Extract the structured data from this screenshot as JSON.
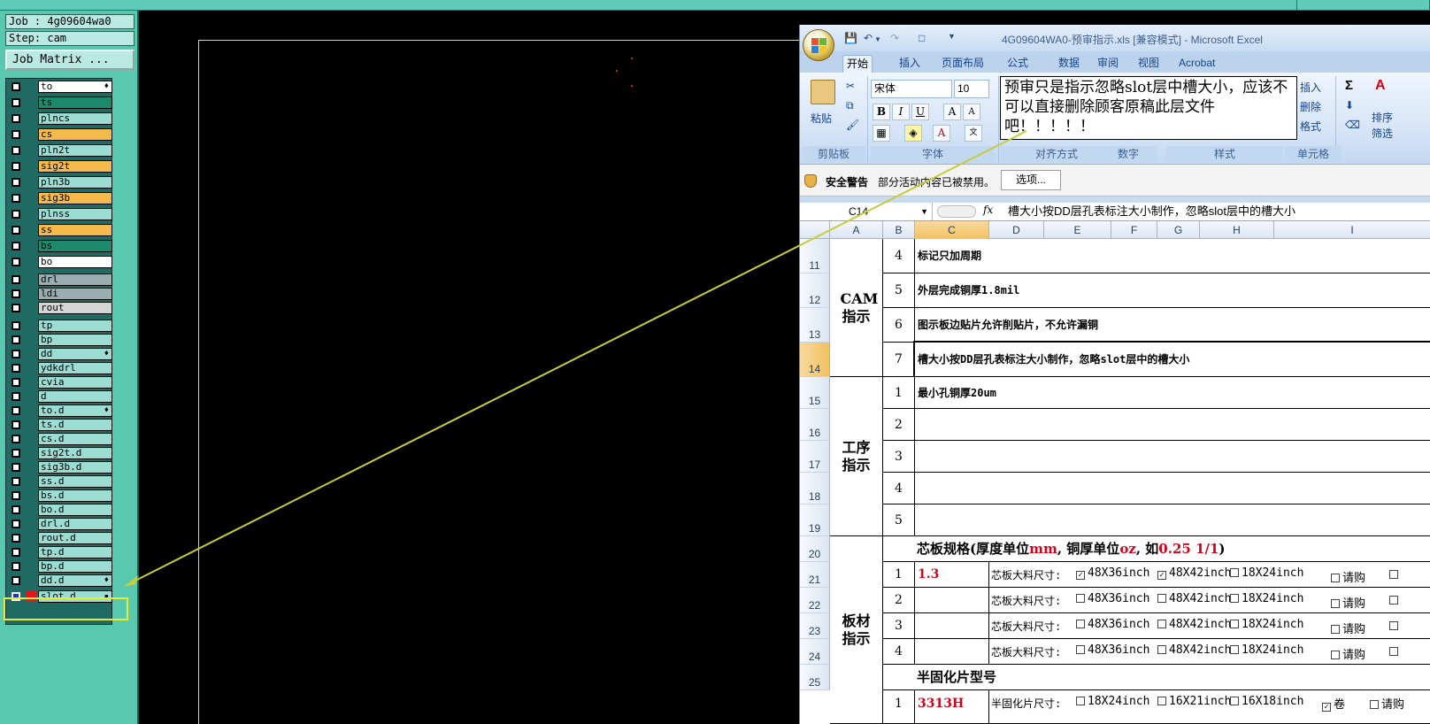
{
  "job": {
    "job_line": "Job : 4g09604wa0",
    "step_line": "Step: cam",
    "matrix_button": "Job Matrix ..."
  },
  "layers": [
    {
      "name": "to",
      "color": "#ffffff",
      "mark": "♦"
    },
    {
      "name": "ts",
      "color": "#1d8a6b",
      "mark": ""
    },
    {
      "name": "plncs",
      "color": "#9bdcd3",
      "mark": ""
    },
    {
      "name": "cs",
      "color": "#f6b94b",
      "mark": ""
    },
    {
      "name": "pln2t",
      "color": "#9bdcd3",
      "mark": ""
    },
    {
      "name": "sig2t",
      "color": "#f6b94b",
      "mark": ""
    },
    {
      "name": "pln3b",
      "color": "#9bdcd3",
      "mark": ""
    },
    {
      "name": "sig3b",
      "color": "#f6b94b",
      "mark": ""
    },
    {
      "name": "plnss",
      "color": "#9bdcd3",
      "mark": ""
    },
    {
      "name": "ss",
      "color": "#f6b94b",
      "mark": ""
    },
    {
      "name": "bs",
      "color": "#1d8a6b",
      "mark": ""
    },
    {
      "name": "bo",
      "color": "#ffffff",
      "mark": ""
    },
    {
      "name": "drl",
      "color": "#9aaeb2",
      "mark": ""
    },
    {
      "name": "ldi",
      "color": "#9aaeb2",
      "mark": ""
    },
    {
      "name": "rout",
      "color": "#d5d5d5",
      "mark": ""
    },
    {
      "name": "tp",
      "color": "#9bdcd3",
      "mark": ""
    },
    {
      "name": "bp",
      "color": "#9bdcd3",
      "mark": ""
    },
    {
      "name": "dd",
      "color": "#9bdcd3",
      "mark": "♦"
    },
    {
      "name": "ydkdrl",
      "color": "#9bdcd3",
      "mark": ""
    },
    {
      "name": "cvia",
      "color": "#9bdcd3",
      "mark": ""
    },
    {
      "name": "d",
      "color": "#9bdcd3",
      "mark": ""
    },
    {
      "name": "to.d",
      "color": "#9bdcd3",
      "mark": "♦"
    },
    {
      "name": "ts.d",
      "color": "#9bdcd3",
      "mark": ""
    },
    {
      "name": "cs.d",
      "color": "#9bdcd3",
      "mark": ""
    },
    {
      "name": "sig2t.d",
      "color": "#9bdcd3",
      "mark": ""
    },
    {
      "name": "sig3b.d",
      "color": "#9bdcd3",
      "mark": ""
    },
    {
      "name": "ss.d",
      "color": "#9bdcd3",
      "mark": ""
    },
    {
      "name": "bs.d",
      "color": "#9bdcd3",
      "mark": ""
    },
    {
      "name": "bo.d",
      "color": "#9bdcd3",
      "mark": ""
    },
    {
      "name": "drl.d",
      "color": "#9bdcd3",
      "mark": ""
    },
    {
      "name": "rout.d",
      "color": "#9bdcd3",
      "mark": ""
    },
    {
      "name": "tp.d",
      "color": "#9bdcd3",
      "mark": ""
    },
    {
      "name": "bp.d",
      "color": "#9bdcd3",
      "mark": ""
    },
    {
      "name": "dd.d",
      "color": "#9bdcd3",
      "mark": "♦"
    },
    {
      "name": "slot.d",
      "color": "#9bdcd3",
      "mark": "▪"
    }
  ],
  "excel": {
    "title": "4G09604WA0-预审指示.xls  [兼容模式] - Microsoft Excel",
    "tabs": [
      "开始",
      "插入",
      "页面布局",
      "公式",
      "数据",
      "审阅",
      "视图",
      "Acrobat"
    ],
    "ribbon": {
      "paste": "粘贴",
      "font_name": "宋体",
      "font_size": "10",
      "groups": [
        "剪贴板",
        "字体",
        "对齐方式",
        "数字",
        "样式",
        "单元格"
      ],
      "insert": "插入",
      "delete": "删除",
      "format": "格式",
      "sort": "排序",
      "filter": "筛选"
    },
    "annotation": "预审只是指示忽略slot层中槽大小，应该不可以直接删除顾客原稿此层文件吧！！！！！",
    "security": {
      "label": "安全警告",
      "message": "部分活动内容已被禁用。",
      "button": "选项..."
    },
    "name_box": "C14",
    "fx": "fx",
    "formula": "槽大小按DD层孔表标注大小制作，忽略slot层中的槽大小",
    "columns": [
      "A",
      "B",
      "C",
      "D",
      "E",
      "F",
      "G",
      "H",
      "I"
    ],
    "rows": [
      "11",
      "12",
      "13",
      "14",
      "15",
      "16",
      "17",
      "18",
      "19",
      "20",
      "21",
      "22",
      "23",
      "24",
      "25"
    ],
    "sections": {
      "cam": "CAM 指示",
      "process": "工序 指示",
      "material": "板材 指示"
    },
    "cam_items": [
      {
        "n": "4",
        "text": "标记只加周期"
      },
      {
        "n": "5",
        "text": "外层完成铜厚1.8mil"
      },
      {
        "n": "6",
        "text": "图示板边贴片允许削贴片，不允许漏铜"
      },
      {
        "n": "7",
        "text": "槽大小按DD层孔表标注大小制作，忽略slot层中的槽大小"
      }
    ],
    "process_items": [
      {
        "n": "1",
        "text": "最小孔铜厚20um"
      },
      {
        "n": "2",
        "text": ""
      },
      {
        "n": "3",
        "text": ""
      },
      {
        "n": "4",
        "text": ""
      },
      {
        "n": "5",
        "text": ""
      }
    ],
    "core_header": {
      "prefix": "芯板规格(厚度单位",
      "mm": "mm",
      "mid": ", 铜厚单位",
      "oz": "oz",
      "mid2": ", 如",
      "eg": "0.25 1/1",
      "suffix": ")"
    },
    "core_rows": [
      {
        "n": "1",
        "val": "1.3"
      },
      {
        "n": "2",
        "val": ""
      },
      {
        "n": "3",
        "val": ""
      },
      {
        "n": "4",
        "val": ""
      }
    ],
    "core_label": "芯板大料尺寸:",
    "core_sizes": [
      "48X36inch",
      "48X42inch",
      "18X24inch"
    ],
    "core_buy": "请购",
    "prepreg_header": "半固化片型号",
    "prepreg_row": {
      "n": "1",
      "val": "3313H",
      "label": "半固化片尺寸:",
      "sizes": [
        "18X24inch",
        "16X21inch",
        "16X18inch"
      ],
      "roll": "卷",
      "buy": "请购"
    }
  }
}
